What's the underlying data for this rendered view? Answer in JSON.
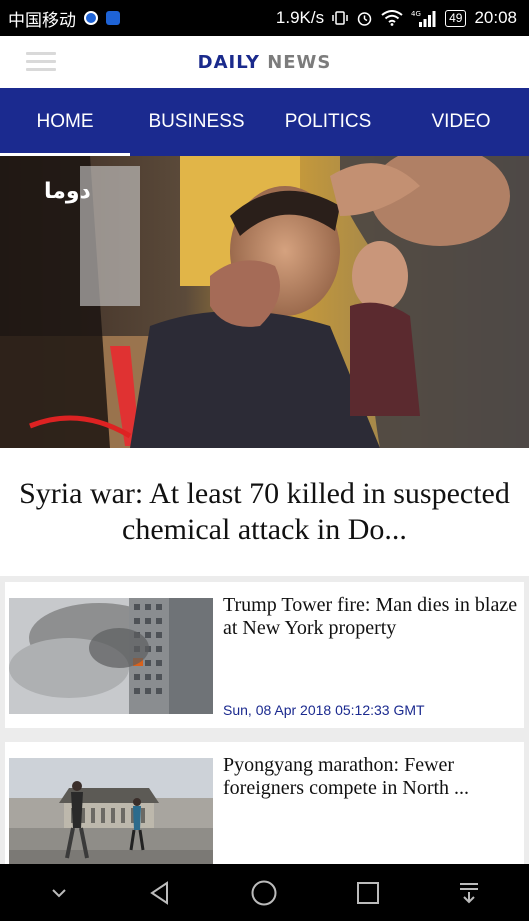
{
  "status_bar": {
    "carrier": "中国移动",
    "network_speed": "1.9K/s",
    "network_type": "4G",
    "battery": "49",
    "time": "20:08"
  },
  "header": {
    "logo_part1": "DAILY",
    "logo_part2": "NEWS"
  },
  "nav": {
    "tabs": [
      {
        "label": "HOME",
        "active": true
      },
      {
        "label": "BUSINESS",
        "active": false
      },
      {
        "label": "POLITICS",
        "active": false
      },
      {
        "label": "VIDEO",
        "active": false
      }
    ]
  },
  "hero": {
    "title": "Syria war: At least 70 killed in suspected chemical attack in Do...",
    "watermark": "دوما"
  },
  "articles": [
    {
      "title": "Trump Tower fire: Man dies in blaze at New York property",
      "date": "Sun, 08 Apr 2018 05:12:33 GMT"
    },
    {
      "title": "Pyongyang marathon: Fewer foreigners compete in North ...",
      "date": ""
    }
  ],
  "colors": {
    "brand_blue": "#1b2a8f",
    "logo_grey": "#7c7c7c"
  }
}
